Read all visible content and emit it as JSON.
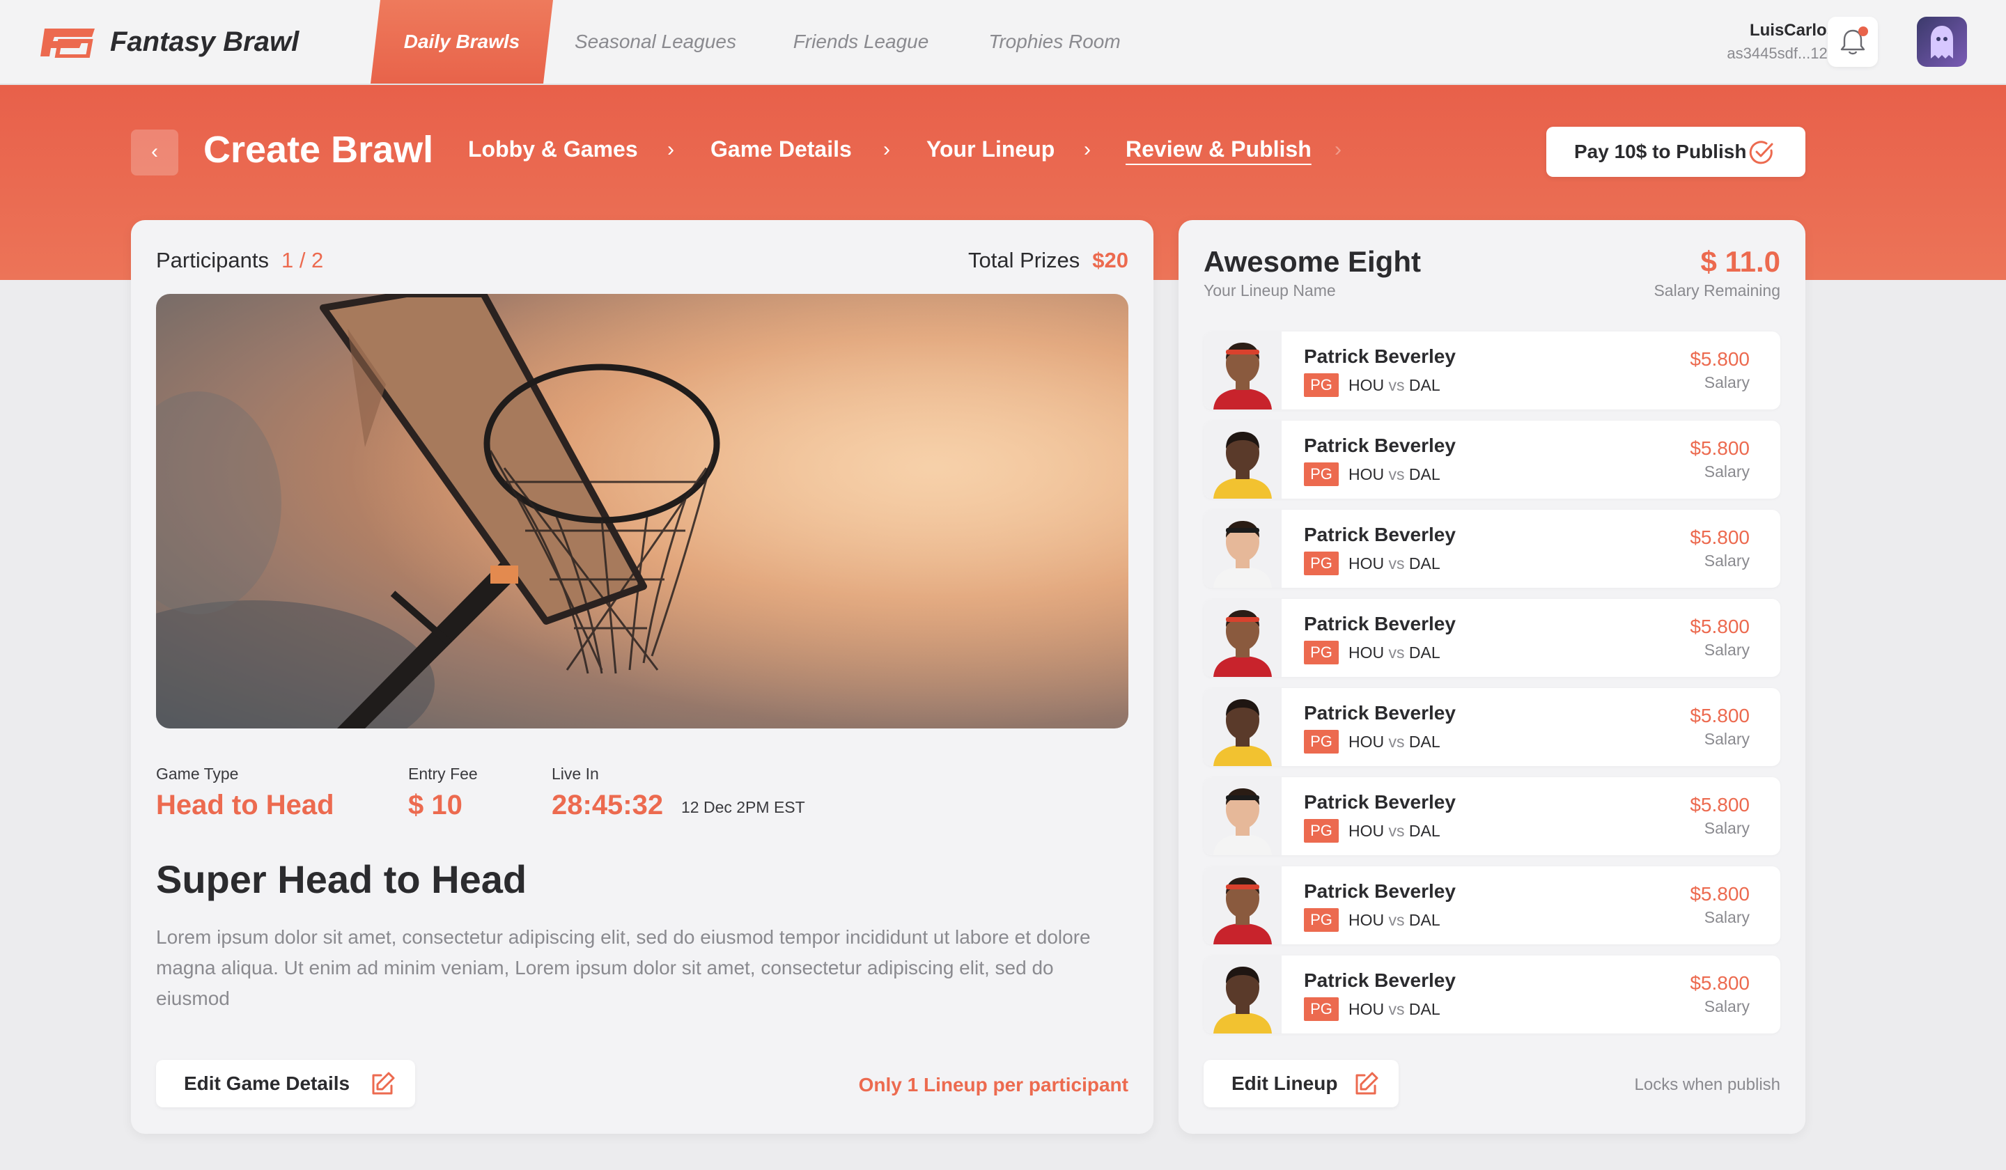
{
  "brand": {
    "name": "Fantasy Brawl"
  },
  "nav": {
    "tabs": [
      {
        "label": "Daily Brawls",
        "active": true
      },
      {
        "label": "Seasonal Leagues",
        "active": false
      },
      {
        "label": "Friends League",
        "active": false
      },
      {
        "label": "Trophies Room",
        "active": false
      }
    ]
  },
  "user": {
    "name": "LuisCarlos",
    "id": "as3445sdf...123",
    "has_notification": true
  },
  "header": {
    "title": "Create Brawl",
    "steps": [
      "Lobby & Games",
      "Game Details",
      "Your Lineup",
      "Review & Publish"
    ],
    "current_step": "Review & Publish",
    "pay_label": "Pay 10$ to Publish"
  },
  "game": {
    "participants_label": "Participants",
    "participants_value": "1 / 2",
    "prizes_label": "Total Prizes",
    "prizes_value": "$20",
    "game_type_label": "Game Type",
    "game_type_value": "Head to Head",
    "entry_fee_label": "Entry Fee",
    "entry_fee_value": "$ 10",
    "live_in_label": "Live In",
    "live_in_value": "28:45:32",
    "live_in_date": "12 Dec 2PM EST",
    "title": "Super Head to Head",
    "description": "Lorem ipsum dolor sit amet, consectetur adipiscing elit, sed do eiusmod tempor incididunt ut labore et dolore magna aliqua. Ut enim ad minim veniam, Lorem ipsum dolor sit amet, consectetur adipiscing elit, sed do eiusmod",
    "edit_label": "Edit Game Details",
    "note": "Only 1 Lineup per participant"
  },
  "lineup": {
    "name": "Awesome Eight",
    "name_label": "Your Lineup Name",
    "salary_remaining": "$ 11.0",
    "salary_remaining_label": "Salary Remaining",
    "edit_label": "Edit Lineup",
    "note": "Locks when publish",
    "players": [
      {
        "name": "Patrick Beverley",
        "position": "PG",
        "home": "HOU",
        "vs": "vs",
        "away": "DAL",
        "salary": "$5.800",
        "salary_label": "Salary",
        "face": "red-jersey"
      },
      {
        "name": "Patrick Beverley",
        "position": "PG",
        "home": "HOU",
        "vs": "vs",
        "away": "DAL",
        "salary": "$5.800",
        "salary_label": "Salary",
        "face": "yellow-jersey"
      },
      {
        "name": "Patrick Beverley",
        "position": "PG",
        "home": "HOU",
        "vs": "vs",
        "away": "DAL",
        "salary": "$5.800",
        "salary_label": "Salary",
        "face": "white-jersey"
      },
      {
        "name": "Patrick Beverley",
        "position": "PG",
        "home": "HOU",
        "vs": "vs",
        "away": "DAL",
        "salary": "$5.800",
        "salary_label": "Salary",
        "face": "red-jersey"
      },
      {
        "name": "Patrick Beverley",
        "position": "PG",
        "home": "HOU",
        "vs": "vs",
        "away": "DAL",
        "salary": "$5.800",
        "salary_label": "Salary",
        "face": "yellow-jersey"
      },
      {
        "name": "Patrick Beverley",
        "position": "PG",
        "home": "HOU",
        "vs": "vs",
        "away": "DAL",
        "salary": "$5.800",
        "salary_label": "Salary",
        "face": "white-jersey"
      },
      {
        "name": "Patrick Beverley",
        "position": "PG",
        "home": "HOU",
        "vs": "vs",
        "away": "DAL",
        "salary": "$5.800",
        "salary_label": "Salary",
        "face": "red-jersey"
      },
      {
        "name": "Patrick Beverley",
        "position": "PG",
        "home": "HOU",
        "vs": "vs",
        "away": "DAL",
        "salary": "$5.800",
        "salary_label": "Salary",
        "face": "yellow-jersey"
      }
    ]
  },
  "colors": {
    "accent": "#ec6a4f",
    "hero": "#e8604a",
    "text": "#2b2b2e",
    "muted": "#8a8a8f"
  },
  "icons": [
    "brand-logo-icon",
    "bell-icon",
    "ghost-avatar-icon",
    "chevron-left-icon",
    "chevron-right-icon",
    "check-circle-icon",
    "edit-icon",
    "basketball-hoop-image",
    "player-headshot"
  ]
}
